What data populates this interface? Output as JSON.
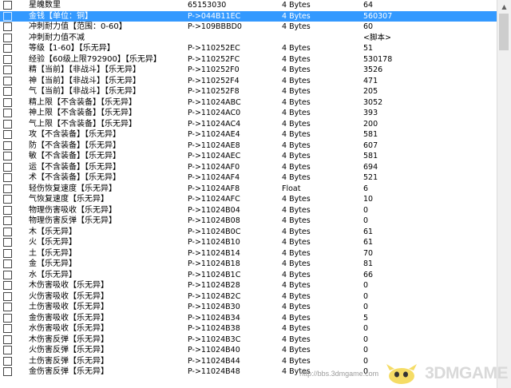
{
  "rows": [
    {
      "checked": false,
      "selected": false,
      "desc": "星魄数里",
      "address": "65153030",
      "type": "4 Bytes",
      "value": "64"
    },
    {
      "checked": false,
      "selected": true,
      "desc": "金钱【单位：铜】",
      "address": "P->044B11EC",
      "type": "4 Bytes",
      "value": "560307"
    },
    {
      "checked": false,
      "selected": false,
      "desc": "冲刺耐力值【范围：0-60】",
      "address": "P->109BBBD0",
      "type": "4 Bytes",
      "value": "60"
    },
    {
      "checked": false,
      "selected": false,
      "desc": "冲刺耐力值不减",
      "address": "",
      "type": "",
      "value": "<脚本>"
    },
    {
      "checked": false,
      "selected": false,
      "desc": "等级【1-60】【乐无异】",
      "address": "P->110252EC",
      "type": "4 Bytes",
      "value": "51"
    },
    {
      "checked": false,
      "selected": false,
      "desc": "经验【60级上限792900】【乐无异】",
      "address": "P->110252FC",
      "type": "4 Bytes",
      "value": "530178"
    },
    {
      "checked": false,
      "selected": false,
      "desc": "精【当前】【非战斗】【乐无异】",
      "address": "P->110252F0",
      "type": "4 Bytes",
      "value": "3526"
    },
    {
      "checked": false,
      "selected": false,
      "desc": "神【当前】【非战斗】【乐无异】",
      "address": "P->110252F4",
      "type": "4 Bytes",
      "value": "471"
    },
    {
      "checked": false,
      "selected": false,
      "desc": "气【当前】【非战斗】【乐无异】",
      "address": "P->110252F8",
      "type": "4 Bytes",
      "value": "205"
    },
    {
      "checked": false,
      "selected": false,
      "desc": "精上限【不含装备】【乐无异】",
      "address": "P->11024ABC",
      "type": "4 Bytes",
      "value": "3052"
    },
    {
      "checked": false,
      "selected": false,
      "desc": "神上限【不含装备】【乐无异】",
      "address": "P->11024AC0",
      "type": "4 Bytes",
      "value": "393"
    },
    {
      "checked": false,
      "selected": false,
      "desc": "气上限【不含装备】【乐无异】",
      "address": "P->11024AC4",
      "type": "4 Bytes",
      "value": "200"
    },
    {
      "checked": false,
      "selected": false,
      "desc": "攻【不含装备】【乐无异】",
      "address": "P->11024AE4",
      "type": "4 Bytes",
      "value": "581"
    },
    {
      "checked": false,
      "selected": false,
      "desc": "防【不含装备】【乐无异】",
      "address": "P->11024AE8",
      "type": "4 Bytes",
      "value": "607"
    },
    {
      "checked": false,
      "selected": false,
      "desc": "敏【不含装备】【乐无异】",
      "address": "P->11024AEC",
      "type": "4 Bytes",
      "value": "581"
    },
    {
      "checked": false,
      "selected": false,
      "desc": "运【不含装备】【乐无异】",
      "address": "P->11024AF0",
      "type": "4 Bytes",
      "value": "694"
    },
    {
      "checked": false,
      "selected": false,
      "desc": "术【不含装备】【乐无异】",
      "address": "P->11024AF4",
      "type": "4 Bytes",
      "value": "521"
    },
    {
      "checked": false,
      "selected": false,
      "desc": "轻伤恢复速度【乐无异】",
      "address": "P->11024AF8",
      "type": "Float",
      "value": "6"
    },
    {
      "checked": false,
      "selected": false,
      "desc": "气恢复速度【乐无异】",
      "address": "P->11024AFC",
      "type": "4 Bytes",
      "value": "10"
    },
    {
      "checked": false,
      "selected": false,
      "desc": "物理伤害吸收【乐无异】",
      "address": "P->11024B04",
      "type": "4 Bytes",
      "value": "0"
    },
    {
      "checked": false,
      "selected": false,
      "desc": "物理伤害反弹【乐无异】",
      "address": "P->11024B08",
      "type": "4 Bytes",
      "value": "0"
    },
    {
      "checked": false,
      "selected": false,
      "desc": "木【乐无异】",
      "address": "P->11024B0C",
      "type": "4 Bytes",
      "value": "61"
    },
    {
      "checked": false,
      "selected": false,
      "desc": "火【乐无异】",
      "address": "P->11024B10",
      "type": "4 Bytes",
      "value": "61"
    },
    {
      "checked": false,
      "selected": false,
      "desc": "土【乐无异】",
      "address": "P->11024B14",
      "type": "4 Bytes",
      "value": "70"
    },
    {
      "checked": false,
      "selected": false,
      "desc": "金【乐无异】",
      "address": "P->11024B18",
      "type": "4 Bytes",
      "value": "81"
    },
    {
      "checked": false,
      "selected": false,
      "desc": "水【乐无异】",
      "address": "P->11024B1C",
      "type": "4 Bytes",
      "value": "66"
    },
    {
      "checked": false,
      "selected": false,
      "desc": "木伤害吸收【乐无异】",
      "address": "P->11024B28",
      "type": "4 Bytes",
      "value": "0"
    },
    {
      "checked": false,
      "selected": false,
      "desc": "火伤害吸收【乐无异】",
      "address": "P->11024B2C",
      "type": "4 Bytes",
      "value": "0"
    },
    {
      "checked": false,
      "selected": false,
      "desc": "土伤害吸收【乐无异】",
      "address": "P->11024B30",
      "type": "4 Bytes",
      "value": "0"
    },
    {
      "checked": false,
      "selected": false,
      "desc": "金伤害吸收【乐无异】",
      "address": "P->11024B34",
      "type": "4 Bytes",
      "value": "5"
    },
    {
      "checked": false,
      "selected": false,
      "desc": "水伤害吸收【乐无异】",
      "address": "P->11024B38",
      "type": "4 Bytes",
      "value": "0"
    },
    {
      "checked": false,
      "selected": false,
      "desc": "木伤害反弹【乐无异】",
      "address": "P->11024B3C",
      "type": "4 Bytes",
      "value": "0"
    },
    {
      "checked": false,
      "selected": false,
      "desc": "火伤害反弹【乐无异】",
      "address": "P->11024B40",
      "type": "4 Bytes",
      "value": "0"
    },
    {
      "checked": false,
      "selected": false,
      "desc": "土伤害反弹【乐无异】",
      "address": "P->11024B44",
      "type": "4 Bytes",
      "value": "0"
    },
    {
      "checked": false,
      "selected": false,
      "desc": "金伤害反弹【乐无异】",
      "address": "P->11024B48",
      "type": "4 Bytes",
      "value": "0"
    }
  ],
  "watermark": {
    "url": "http://bbs.3dmgame.com",
    "brand": "3DMGAME"
  }
}
